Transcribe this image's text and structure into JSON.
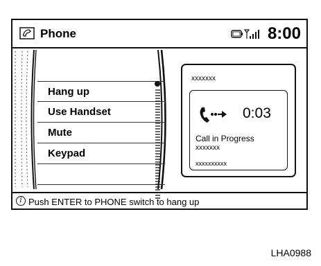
{
  "header": {
    "title": "Phone",
    "time": "8:00",
    "icons": [
      "phone-handset-icon",
      "battery-icon",
      "signal-strength-icon"
    ]
  },
  "menu": {
    "items": [
      {
        "label": "Hang up",
        "selected": true
      },
      {
        "label": "Use Handset",
        "selected": false
      },
      {
        "label": "Mute",
        "selected": false
      },
      {
        "label": "Keypad",
        "selected": false
      },
      {
        "label": "",
        "selected": false
      }
    ]
  },
  "call": {
    "caller_top": "xxxxxxx",
    "duration": "0:03",
    "status": "Call in Progress",
    "caller_id": "xxxxxxx",
    "caller_number": "xxxxxxxxxx",
    "icon": "phone-call-icon"
  },
  "info_bar": {
    "icon": "info-icon",
    "text": "Push ENTER to PHONE switch to hang up"
  },
  "figure_code": "LHA0988",
  "colors": {
    "line": "#111111",
    "background": "#ffffff"
  }
}
